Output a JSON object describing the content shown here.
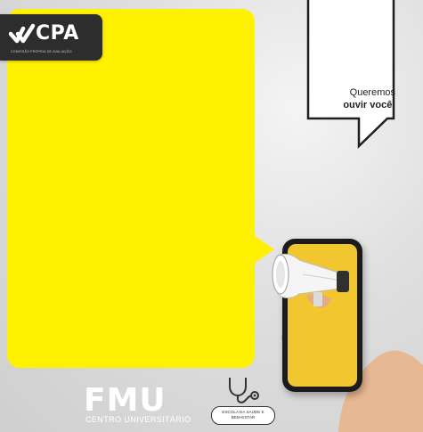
{
  "cpa": {
    "title": "CPA",
    "subtitle": "COMISSÃO PRÓPRIA DE AVALIAÇÃO",
    "icon": "checkmark-icon"
  },
  "callout": {
    "line1": "Queremos",
    "line2": "ouvir você!"
  },
  "fmu": {
    "title": "FMU",
    "subtitle": "CENTRO UNIVERSITÁRIO"
  },
  "school": {
    "line1": "ESCOLA DA SAÚDE E",
    "line2": "BEM-ESTAR",
    "icon": "stethoscope-icon"
  },
  "colors": {
    "yellow": "#fff200",
    "dark_badge": "#2d2d2d",
    "phone_screen": "#f2c62f"
  }
}
